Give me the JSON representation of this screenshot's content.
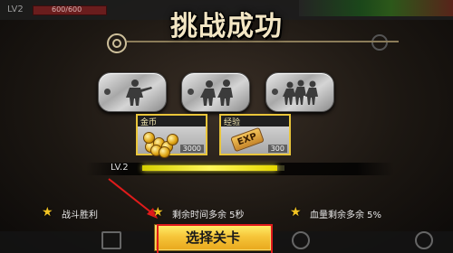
{
  "hud": {
    "level": "LV2",
    "hp": "600/600"
  },
  "title": "挑战成功",
  "reward_cards": [
    {
      "name": "金币",
      "quantity": "3000",
      "icon": "coins-icon"
    },
    {
      "name": "经验",
      "quantity": "300",
      "icon": "exp-icon",
      "badge": "EXP"
    }
  ],
  "level_bar": {
    "label": "LV.2",
    "progress": 0.95
  },
  "objectives": [
    {
      "text": "战斗胜利",
      "icon": "star-icon"
    },
    {
      "text": "剩余时间多余  5秒",
      "icon": "star-icon"
    },
    {
      "text": "血量剩余多余  5%",
      "icon": "star-icon"
    }
  ],
  "button": {
    "label": "选择关卡"
  },
  "colors": {
    "accent_gold": "#f6c53a",
    "annotation_red": "#e01b1b",
    "star": "#f2c323",
    "bar_fill": "#fff65a"
  }
}
